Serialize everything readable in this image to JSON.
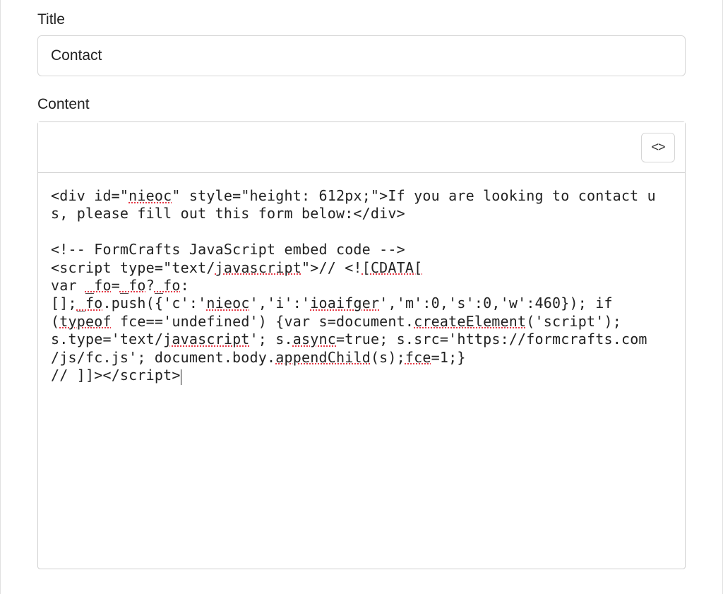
{
  "title_field": {
    "label": "Title",
    "value": "Contact"
  },
  "content_field": {
    "label": "Content",
    "code_toggle_glyph": "<>"
  },
  "code_tokens": {
    "t0": "<div id=\"",
    "t1": "nieoc",
    "t2": "\" style=\"height: 612px;\">If you are looking to contact us, please fill out this form below:</div>",
    "blank": "",
    "t3": "<!-- FormCrafts JavaScript embed code -->",
    "t4a": "<script type=\"text/",
    "t4b": "javascript",
    "t4c": "\">// <!",
    "t4d": "[CDATA[",
    "t5a": "var ",
    "t5b": "_fo",
    "t5c": "=",
    "t5d": "_fo",
    "t5e": "?",
    "t5f": "_fo",
    "t5g": ":",
    "t6a": "[];",
    "t6b": "_fo",
    "t6c": ".push({'c':'",
    "t6d": "nieoc",
    "t6e": "','i':'",
    "t6f": "ioaifger",
    "t6g": "','m':0,'s':0,'w':460}); if",
    "t7a": "(",
    "t7b": "typeof",
    "t7c": " fce=='undefined') {var s=document.",
    "t7d": "createElement",
    "t7e": "('script');",
    "t8a": "s.type='text/",
    "t8b": "javascript",
    "t8c": "'; s.",
    "t8d": "async",
    "t8e": "=true; s.src='https://formcrafts.com",
    "t9a": "/js/fc.js'; document.body.",
    "t9b": "appendChild",
    "t9c": "(s);",
    "t9d": "fce",
    "t9e": "=1;}",
    "t10": "// ]]><",
    "t10b": "/script>"
  }
}
